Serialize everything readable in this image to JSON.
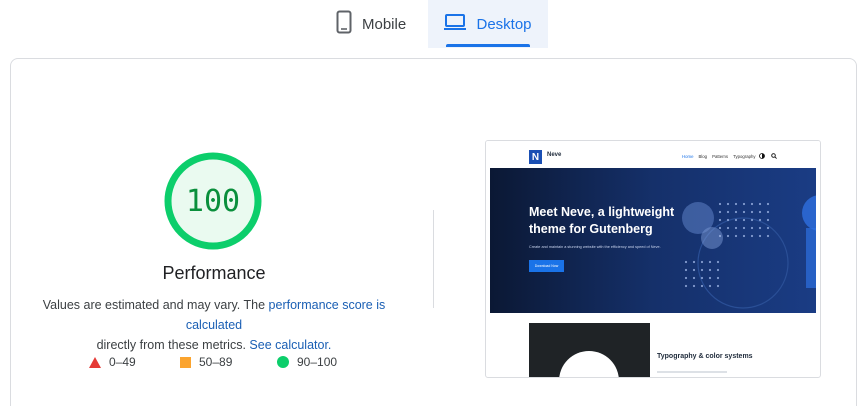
{
  "tabs": {
    "mobile_label": "Mobile",
    "desktop_label": "Desktop",
    "active": "desktop",
    "accent_color": "#1a73e8"
  },
  "score": {
    "value": "100",
    "fraction": 1.0,
    "title": "Performance",
    "color": "#0cce6b"
  },
  "description": {
    "text_before": "Values are estimated and may vary. The ",
    "link_score": "performance score is calculated",
    "text_middle": " directly from these metrics. ",
    "link_calculator": "See calculator."
  },
  "legend": {
    "fail": "0–49",
    "average": "50–89",
    "pass": "90–100",
    "fail_color": "#e53935",
    "average_color": "#fba42f",
    "pass_color": "#0cce6b"
  },
  "thumbnail": {
    "brand": "Neve",
    "logo_letter": "N",
    "menu": [
      "Home",
      "Blog",
      "Patterns",
      "Typography"
    ],
    "hero_title": "Meet Neve, a lightweight theme for Gutenberg",
    "hero_subtitle": "Create and maintain a stunning website with the efficiency and speed of Neve.",
    "hero_button": "Download Now",
    "section_title": "Typography & color systems"
  },
  "icons": {
    "mobile": "smartphone-icon",
    "desktop": "laptop-icon",
    "theme_toggle": "contrast-icon",
    "search": "search-icon"
  }
}
